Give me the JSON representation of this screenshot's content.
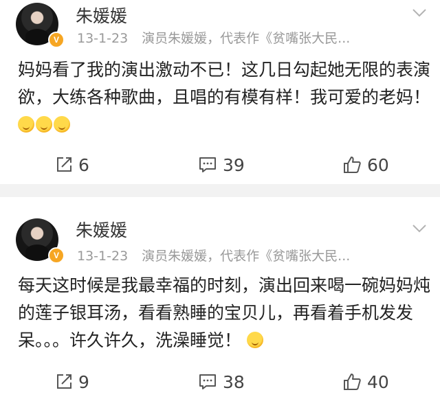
{
  "posts": [
    {
      "username": "朱媛媛",
      "time": "13-1-23",
      "source": "演员朱媛媛，代表作《贫嘴张大民...",
      "text": "妈妈看了我的演出激动不已！这几日勾起她无限的表演欲，大练各种歌曲，且唱的有模有样！我可爱的老妈！",
      "emojis": [
        "kiss-emoji",
        "smile-emoji",
        "laugh-emoji"
      ],
      "reposts": "6",
      "comments": "39",
      "likes": "60"
    },
    {
      "username": "朱媛媛",
      "time": "13-1-23",
      "source": "演员朱媛媛，代表作《贫嘴张大民...",
      "text": "每天这时候是我最幸福的时刻，演出回来喝一碗妈妈炖的莲子银耳汤，看看熟睡的宝贝儿，再看着手机发发呆。。。许久许久，洗澡睡觉！",
      "emojis": [
        "laugh-emoji"
      ],
      "reposts": "9",
      "comments": "38",
      "likes": "40"
    }
  ],
  "icons": {
    "verified_badge": "V",
    "accent": "#f6a623"
  }
}
